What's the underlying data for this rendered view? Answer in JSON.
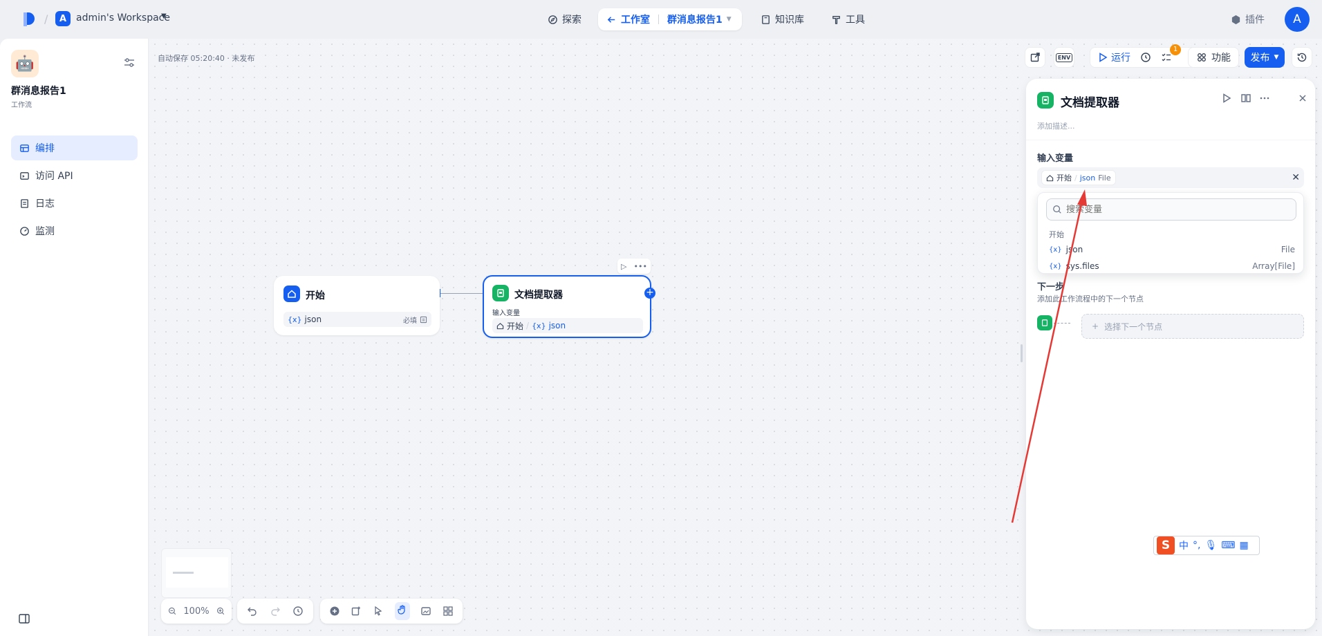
{
  "topbar": {
    "workspace_initial": "A",
    "workspace_name": "admin's Workspace",
    "nav_explore": "探索",
    "nav_studio": "工作室",
    "nav_app": "群消息报告1",
    "nav_knowledge": "知识库",
    "nav_tools": "工具",
    "plugins": "插件",
    "user_initial": "A"
  },
  "sidebar": {
    "app_name": "群消息报告1",
    "app_type": "工作流",
    "items": [
      {
        "label": "编排",
        "icon": "layout-icon"
      },
      {
        "label": "访问 API",
        "icon": "terminal-icon"
      },
      {
        "label": "日志",
        "icon": "file-icon"
      },
      {
        "label": "监测",
        "icon": "gauge-icon"
      }
    ]
  },
  "canvas": {
    "autosave": "自动保存 05:20:40 · 未发布",
    "start_node": {
      "title": "开始",
      "var_prefix": "{x}",
      "var_name": "json",
      "required": "必填"
    },
    "doc_node": {
      "title": "文档提取器",
      "input_label": "输入变量",
      "source": "开始",
      "var_prefix": "{x}",
      "var_name": "json"
    },
    "zoom": "100%"
  },
  "toolbar": {
    "env": "ENV",
    "run": "运行",
    "checklist_count": "1",
    "features": "功能",
    "publish": "发布"
  },
  "panel": {
    "title": "文档提取器",
    "description_placeholder": "添加描述...",
    "input_var_label": "输入变量",
    "selected_source": "开始",
    "selected_var": "json",
    "selected_type": "File",
    "search_placeholder": "搜索变量",
    "group_label": "开始",
    "options": [
      {
        "prefix": "{x}",
        "name": "json",
        "type": "File"
      },
      {
        "prefix": "{x}",
        "name": "sys.files",
        "type": "Array[File]"
      }
    ],
    "next_step_title": "下一步",
    "next_step_desc": "添加此工作流程中的下一个节点",
    "select_next": "选择下一个节点"
  },
  "ime": {
    "brand": "S",
    "lang": "中"
  },
  "colors": {
    "accent": "#155eef",
    "green": "#16b364",
    "annotation": "#e53935"
  }
}
